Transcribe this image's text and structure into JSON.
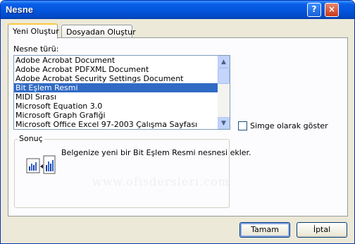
{
  "window": {
    "title": "Nesne"
  },
  "titlebar": {
    "help_label": "?",
    "close_label": "×"
  },
  "tabs": [
    {
      "label": "Yeni Oluştur"
    },
    {
      "label": "Dosyadan Oluştur"
    }
  ],
  "object_type": {
    "label": "Nesne türü:",
    "items": [
      "Adobe Acrobat Document",
      "Adobe Acrobat PDFXML Document",
      "Adobe Acrobat Security Settings Document",
      "Bit Eşlem Resmi",
      "MIDI Sırası",
      "Microsoft Equation 3.0",
      "Microsoft Graph Grafiği",
      "Microsoft Office Excel 97-2003 Çalışma Sayfası"
    ],
    "selected": "Bit Eşlem Resmi"
  },
  "display_as_icon": {
    "label": "Simge olarak göster",
    "checked": false
  },
  "result": {
    "title": "Sonuç",
    "text": "Belgenize yeni bir Bit Eşlem Resmi nesnesi ekler."
  },
  "watermark": "www.ofisdersleri.com",
  "buttons": {
    "ok": "Tamam",
    "cancel": "İptal"
  },
  "colors": {
    "titlebar": "#0355dc",
    "selection": "#316ac5",
    "dialog_bg": "#ece9d8"
  }
}
